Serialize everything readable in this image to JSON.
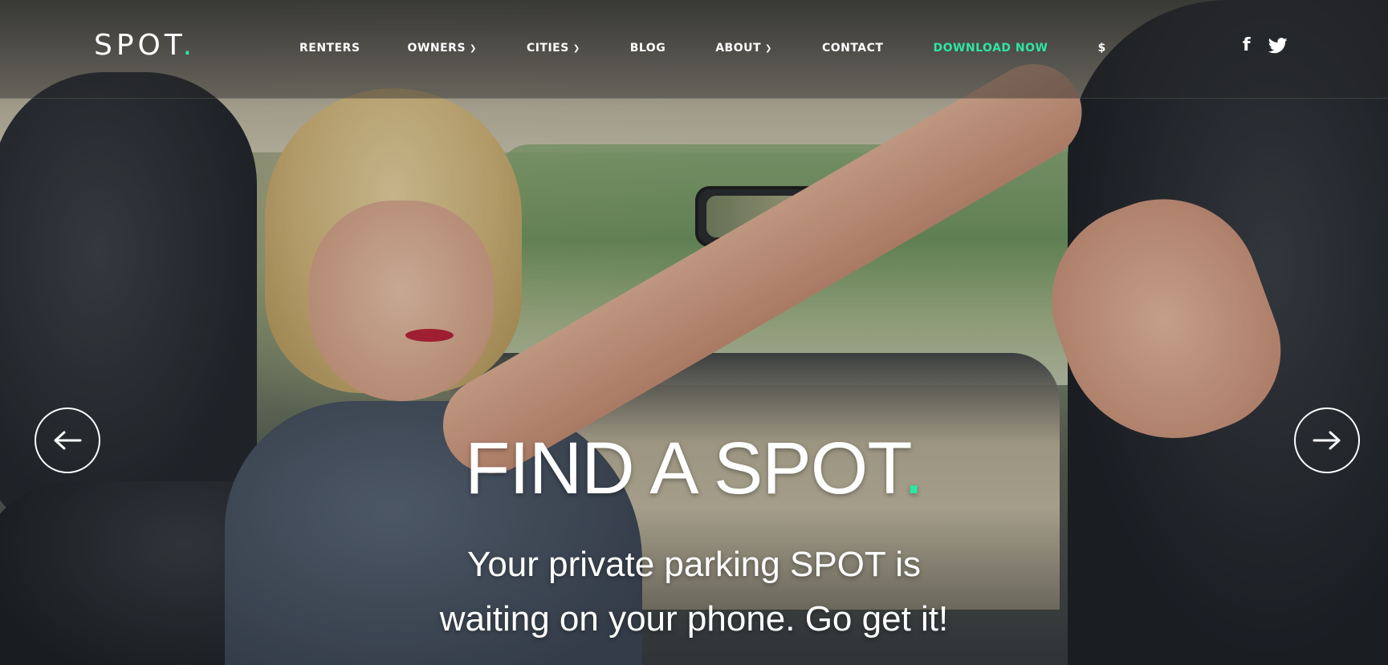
{
  "brand": {
    "name": "SPOT",
    "dot": ".",
    "accent_color": "#2ee6a1"
  },
  "nav": {
    "items": [
      {
        "label": "RENTERS",
        "has_dropdown": false
      },
      {
        "label": "OWNERS",
        "has_dropdown": true
      },
      {
        "label": "CITIES",
        "has_dropdown": true
      },
      {
        "label": "BLOG",
        "has_dropdown": false
      },
      {
        "label": "ABOUT",
        "has_dropdown": true
      },
      {
        "label": "CONTACT",
        "has_dropdown": false
      },
      {
        "label": "DOWNLOAD NOW",
        "has_dropdown": false,
        "accent": true
      },
      {
        "label": "$",
        "has_dropdown": false
      }
    ],
    "social": [
      {
        "icon": "facebook-icon",
        "glyph": "f"
      },
      {
        "icon": "twitter-icon"
      }
    ]
  },
  "hero": {
    "title": "FIND A SPOT",
    "title_dot": ".",
    "subtitle_line1": "Your private parking SPOT is",
    "subtitle_line2": "waiting on your phone. Go get it!",
    "prev_icon": "arrow-left-icon",
    "next_icon": "arrow-right-icon"
  }
}
